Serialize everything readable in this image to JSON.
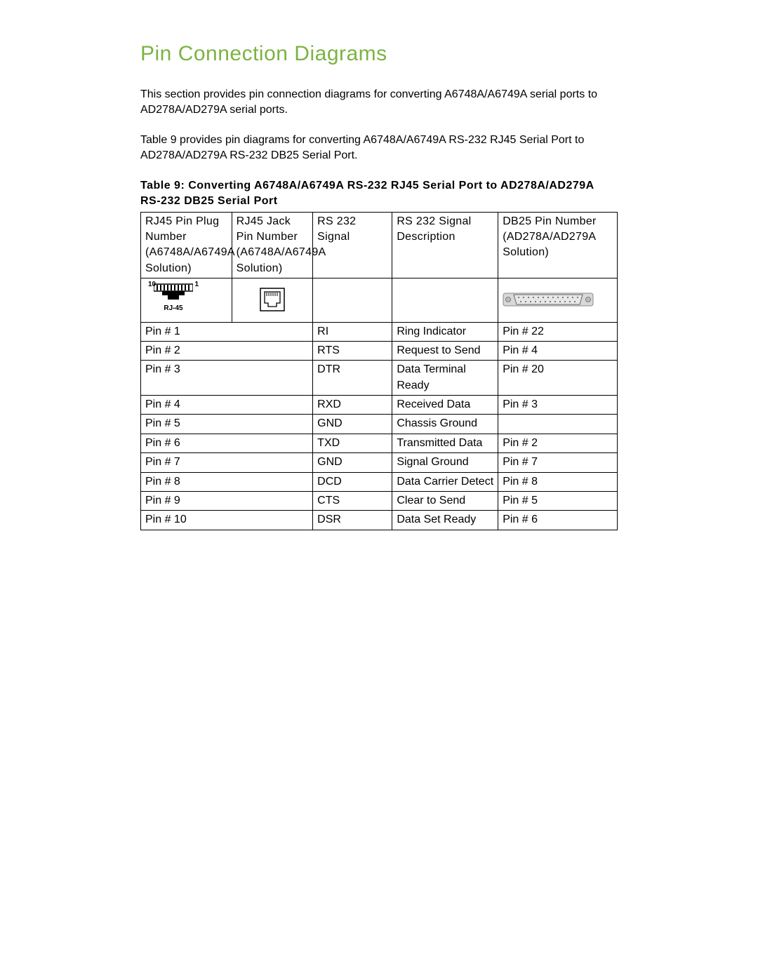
{
  "heading": "Pin Connection Diagrams",
  "para1": "This section provides pin connection diagrams for converting A6748A/A6749A serial ports to AD278A/AD279A serial ports.",
  "para2": "Table 9 provides pin diagrams for converting A6748A/A6749A RS-232 RJ45 Serial Port to AD278A/AD279A RS-232 DB25 Serial Port.",
  "tableTitle": "Table 9: Converting A6748A/A6749A RS-232 RJ45 Serial Port to AD278A/AD279A RS-232 DB25 Serial Port",
  "headers": {
    "c1": "RJ45 Pin Plug Number (A6748A/A6749A Solution)",
    "c2": "RJ45 Jack Pin Number (A6748A/A6749A Solution)",
    "c3": "RS 232 Signal",
    "c4": "RS 232 Signal Description",
    "c5": "DB25 Pin Number (AD278A/AD279A Solution)"
  },
  "rj45Label": {
    "left": "10",
    "right": "1",
    "bottom": "RJ-45"
  },
  "rows": [
    {
      "c1": "Pin # 1",
      "c3": "RI",
      "c4": "Ring Indicator",
      "c5": "Pin # 22"
    },
    {
      "c1": "Pin # 2",
      "c3": "RTS",
      "c4": "Request to Send",
      "c5": "Pin # 4"
    },
    {
      "c1": "Pin # 3",
      "c3": "DTR",
      "c4": "Data Terminal Ready",
      "c5": "Pin # 20"
    },
    {
      "c1": "Pin # 4",
      "c3": "RXD",
      "c4": "Received Data",
      "c5": "Pin # 3"
    },
    {
      "c1": "Pin # 5",
      "c3": "GND",
      "c4": "Chassis Ground",
      "c5": ""
    },
    {
      "c1": "Pin # 6",
      "c3": "TXD",
      "c4": "Transmitted Data",
      "c5": "Pin # 2"
    },
    {
      "c1": "Pin # 7",
      "c3": "GND",
      "c4": "Signal Ground",
      "c5": "Pin # 7"
    },
    {
      "c1": "Pin # 8",
      "c3": "DCD",
      "c4": "Data Carrier Detect",
      "c5": "Pin # 8"
    },
    {
      "c1": "Pin # 9",
      "c3": "CTS",
      "c4": "Clear to Send",
      "c5": "Pin # 5"
    },
    {
      "c1": "Pin # 10",
      "c3": "DSR",
      "c4": "Data Set Ready",
      "c5": "Pin # 6"
    }
  ]
}
